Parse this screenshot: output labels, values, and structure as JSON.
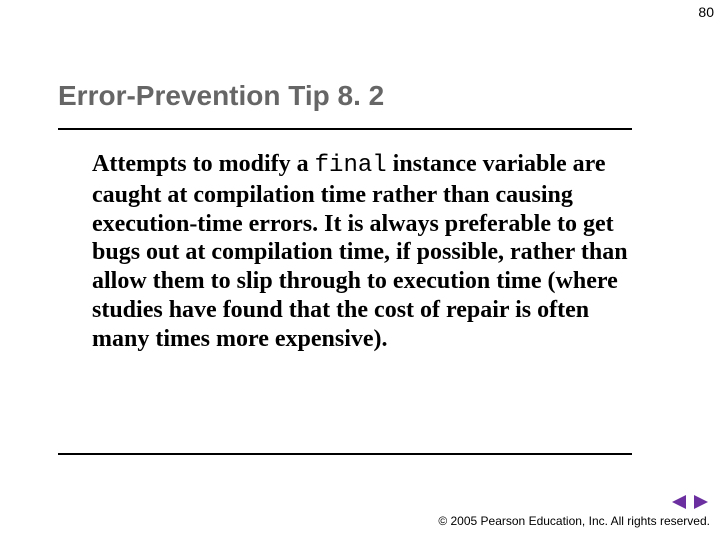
{
  "page_number": "80",
  "title": "Error-Prevention Tip 8. 2",
  "body": {
    "pre": "Attempts to modify a ",
    "code": "final",
    "post": " instance variable are caught at compilation time rather than causing execution-time errors. It is always preferable to get bugs out at compilation time, if possible, rather than allow them to slip through to execution time (where studies have found that the cost of repair is often many times more expensive)."
  },
  "footer": "© 2005 Pearson Education, Inc.  All rights reserved.",
  "nav": {
    "prev_color": "#6b2fa0",
    "next_color": "#6b2fa0"
  }
}
